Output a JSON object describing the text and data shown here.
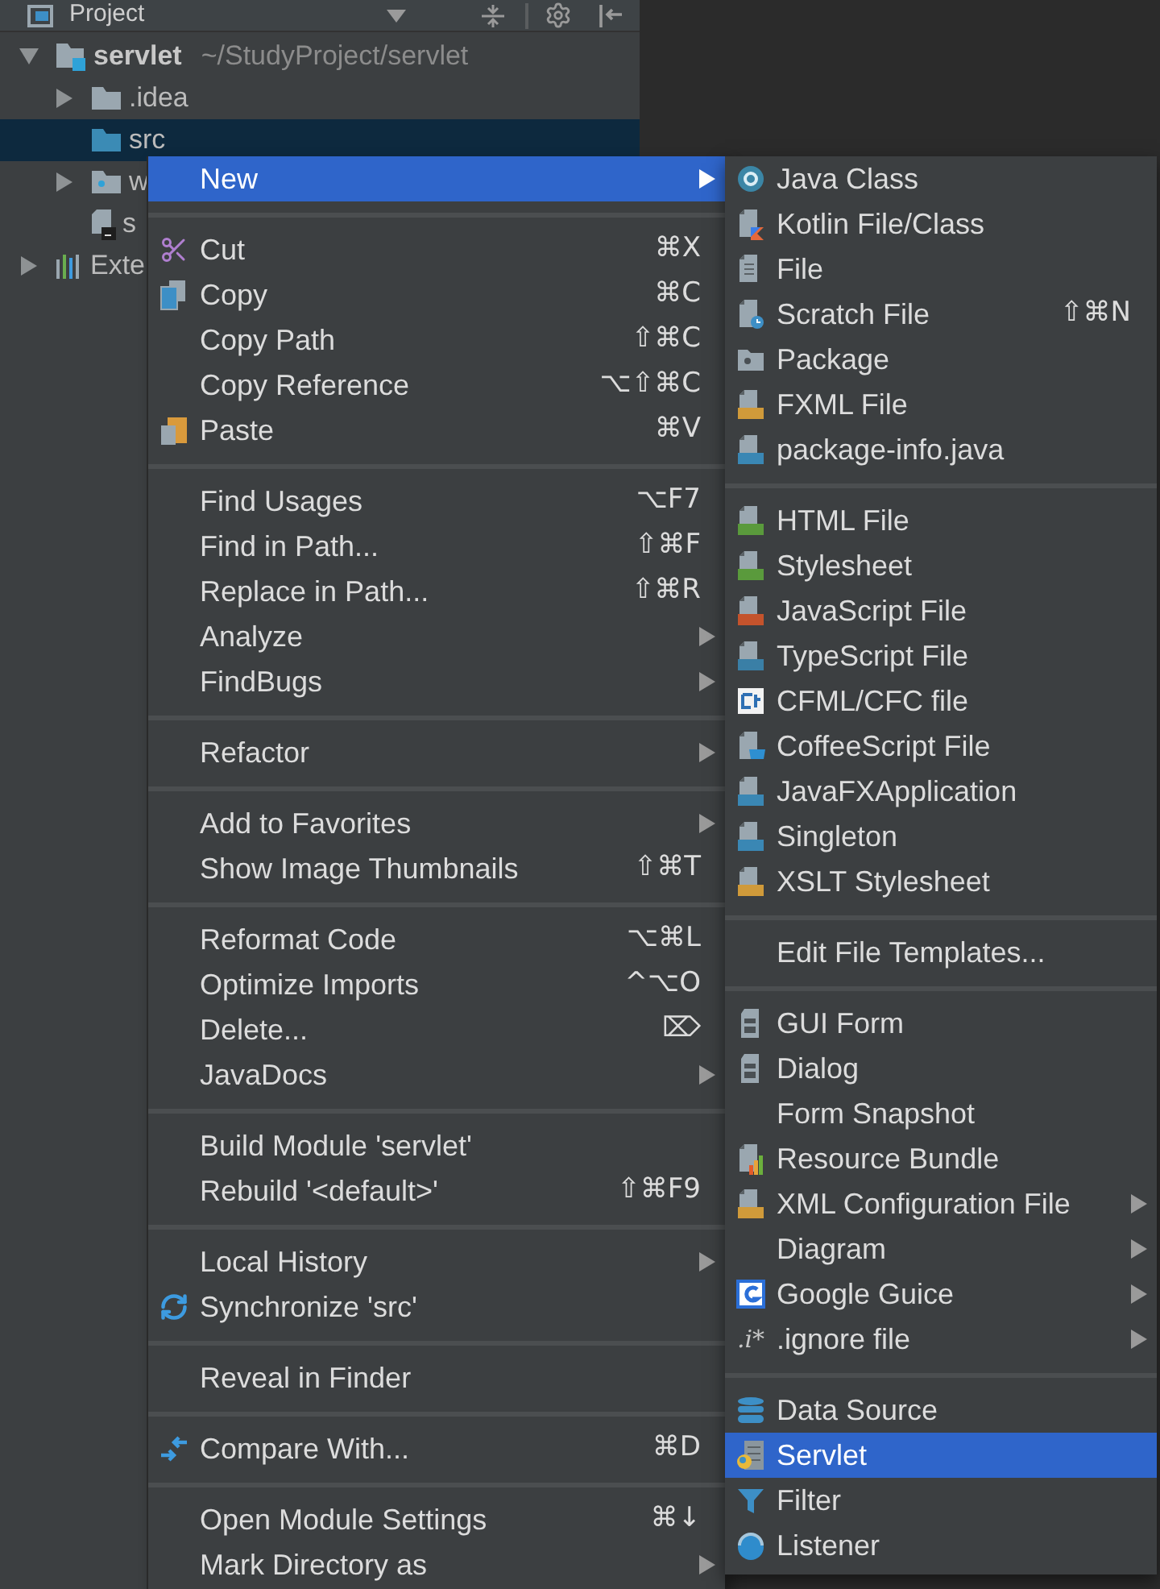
{
  "panel": {
    "title": "Project"
  },
  "tree": [
    {
      "label": "servlet",
      "kind": "module",
      "path": "~/StudyProject/servlet",
      "expanded": true,
      "selected": false,
      "children": [
        {
          "label": ".idea",
          "kind": "folder",
          "expanded": false,
          "selected": false
        },
        {
          "label": "src",
          "kind": "source",
          "selected": true
        },
        {
          "label": "w",
          "kind": "web",
          "expanded": false,
          "selected": false
        },
        {
          "label": "s",
          "kind": "file",
          "selected": false
        }
      ]
    },
    {
      "label": "Exte",
      "kind": "libraries",
      "expanded": false,
      "selected": false
    }
  ],
  "context_menu": {
    "sections": [
      [
        {
          "label": "New",
          "submenu": true,
          "selected": true
        }
      ],
      [
        {
          "label": "Cut",
          "shortcut": "⌘X",
          "submenu": false,
          "selected": false
        },
        {
          "label": "Copy",
          "shortcut": "⌘C",
          "submenu": false,
          "selected": false
        },
        {
          "label": "Copy Path",
          "shortcut": "⇧⌘C",
          "submenu": false,
          "selected": false
        },
        {
          "label": "Copy Reference",
          "shortcut": "⌥⇧⌘C",
          "submenu": false,
          "selected": false
        },
        {
          "label": "Paste",
          "shortcut": "⌘V",
          "submenu": false,
          "selected": false
        }
      ],
      [
        {
          "label": "Find Usages",
          "shortcut": "⌥F7",
          "submenu": false,
          "selected": false
        },
        {
          "label": "Find in Path...",
          "shortcut": "⇧⌘F",
          "submenu": false,
          "selected": false
        },
        {
          "label": "Replace in Path...",
          "shortcut": "⇧⌘R",
          "submenu": false,
          "selected": false
        },
        {
          "label": "Analyze",
          "submenu": true,
          "selected": false
        },
        {
          "label": "FindBugs",
          "submenu": true,
          "selected": false
        }
      ],
      [
        {
          "label": "Refactor",
          "submenu": true,
          "selected": false
        }
      ],
      [
        {
          "label": "Add to Favorites",
          "submenu": true,
          "selected": false
        },
        {
          "label": "Show Image Thumbnails",
          "shortcut": "⇧⌘T",
          "submenu": false,
          "selected": false
        }
      ],
      [
        {
          "label": "Reformat Code",
          "shortcut": "⌥⌘L",
          "submenu": false,
          "selected": false
        },
        {
          "label": "Optimize Imports",
          "shortcut": "^⌥O",
          "submenu": false,
          "selected": false
        },
        {
          "label": "Delete...",
          "shortcut": "⌦",
          "submenu": false,
          "selected": false
        },
        {
          "label": "JavaDocs",
          "submenu": true,
          "selected": false
        }
      ],
      [
        {
          "label": "Build Module 'servlet'",
          "submenu": false,
          "selected": false
        },
        {
          "label": "Rebuild '<default>'",
          "shortcut": "⇧⌘F9",
          "submenu": false,
          "selected": false
        }
      ],
      [
        {
          "label": "Local History",
          "submenu": true,
          "selected": false
        },
        {
          "label": "Synchronize 'src'",
          "submenu": false,
          "selected": false
        }
      ],
      [
        {
          "label": "Reveal in Finder",
          "submenu": false,
          "selected": false
        }
      ],
      [
        {
          "label": "Compare With...",
          "shortcut": "⌘D",
          "submenu": false,
          "selected": false
        }
      ],
      [
        {
          "label": "Open Module Settings",
          "shortcut": "⌘↓",
          "submenu": false,
          "selected": false
        },
        {
          "label": "Mark Directory as",
          "submenu": true,
          "selected": false
        }
      ]
    ]
  },
  "submenu": {
    "sections": [
      [
        {
          "label": "Java Class",
          "submenu": false,
          "selected": false
        },
        {
          "label": "Kotlin File/Class",
          "submenu": false,
          "selected": false
        },
        {
          "label": "File",
          "submenu": false,
          "selected": false
        },
        {
          "label": "Scratch File",
          "shortcut": "⇧⌘N",
          "submenu": false,
          "selected": false
        },
        {
          "label": "Package",
          "submenu": false,
          "selected": false
        },
        {
          "label": "FXML File",
          "submenu": false,
          "selected": false
        },
        {
          "label": "package-info.java",
          "submenu": false,
          "selected": false
        }
      ],
      [
        {
          "label": "HTML File",
          "submenu": false,
          "selected": false
        },
        {
          "label": "Stylesheet",
          "submenu": false,
          "selected": false
        },
        {
          "label": "JavaScript File",
          "submenu": false,
          "selected": false
        },
        {
          "label": "TypeScript File",
          "submenu": false,
          "selected": false
        },
        {
          "label": "CFML/CFC file",
          "submenu": false,
          "selected": false
        },
        {
          "label": "CoffeeScript File",
          "submenu": false,
          "selected": false
        },
        {
          "label": "JavaFXApplication",
          "submenu": false,
          "selected": false
        },
        {
          "label": "Singleton",
          "submenu": false,
          "selected": false
        },
        {
          "label": "XSLT Stylesheet",
          "submenu": false,
          "selected": false
        }
      ],
      [
        {
          "label": "Edit File Templates...",
          "submenu": false,
          "selected": false
        }
      ],
      [
        {
          "label": "GUI Form",
          "submenu": false,
          "selected": false
        },
        {
          "label": "Dialog",
          "submenu": false,
          "selected": false
        },
        {
          "label": "Form Snapshot",
          "submenu": false,
          "selected": false
        },
        {
          "label": "Resource Bundle",
          "submenu": false,
          "selected": false
        },
        {
          "label": "XML Configuration File",
          "submenu": true,
          "selected": false
        },
        {
          "label": "Diagram",
          "submenu": true,
          "selected": false
        },
        {
          "label": "Google Guice",
          "submenu": true,
          "selected": false
        },
        {
          "label": ".ignore file",
          "icon_text": ".i*",
          "submenu": true,
          "selected": false
        }
      ],
      [
        {
          "label": "Data Source",
          "submenu": false,
          "selected": false
        },
        {
          "label": "Servlet",
          "submenu": false,
          "selected": true
        },
        {
          "label": "Filter",
          "submenu": false,
          "selected": false
        },
        {
          "label": "Listener",
          "submenu": false,
          "selected": false
        }
      ]
    ]
  }
}
